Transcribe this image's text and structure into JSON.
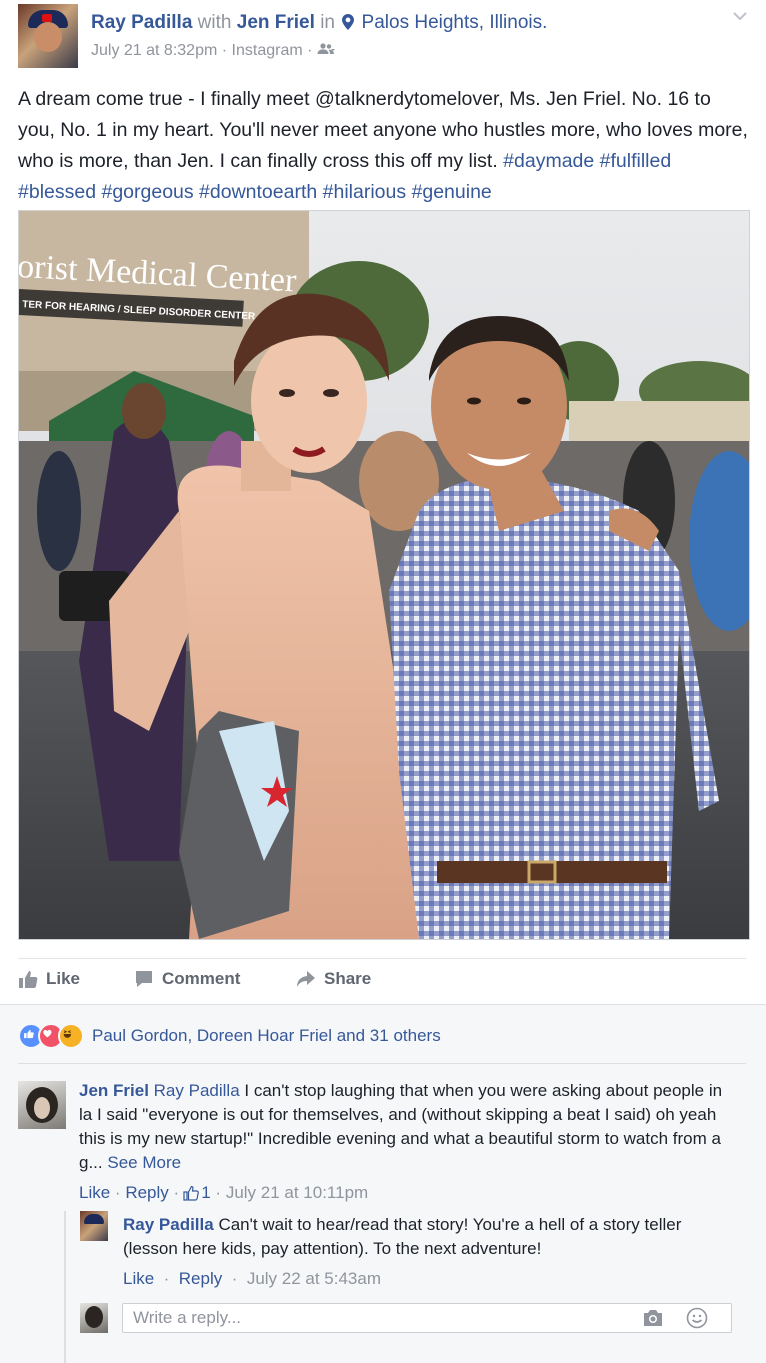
{
  "post": {
    "author": "Ray Padilla",
    "with_label": "with",
    "tagged": "Jen Friel",
    "in_label": "in",
    "location": "Palos Heights, Illinois.",
    "timestamp": "July 21 at 8:32pm",
    "via": "Instagram",
    "dot": "·",
    "text": "A dream come true - I finally meet @talknerdytomelover, Ms. Jen Friel. No. 16 to you, No. 1 in my heart. You'll never meet anyone who hustles more, who loves more, who is more, than Jen. I can finally cross this off my list.",
    "hashtags": "#daymade #fulfilled #blessed #gorgeous #downtoearth #hilarious #genuine",
    "photo_sign_line1": "orist Medical Center",
    "photo_sign_line2": "TER FOR HEARING / SLEEP DISORDER CENTER"
  },
  "actions": {
    "like": "Like",
    "comment": "Comment",
    "share": "Share"
  },
  "reactions": {
    "summary": "Paul Gordon, Doreen Hoar Friel and 31 others"
  },
  "comment1": {
    "author": "Jen Friel",
    "mention": "Ray Padilla",
    "text": "I can't stop laughing that when you were asking about people in la I said \"everyone is out for themselves, and (without skipping a beat I said) oh yeah this is my new startup!\" Incredible evening and what a beautiful storm to watch from a g...",
    "see_more": "See More",
    "like": "Like",
    "reply": "Reply",
    "sep": "·",
    "like_count": "1",
    "timestamp": "July 21 at 10:11pm"
  },
  "reply1": {
    "author": "Ray Padilla",
    "text": "Can't wait to hear/read that story! You're a hell of a story teller (lesson here kids, pay attention). To the next adventure!",
    "like": "Like",
    "reply": "Reply",
    "sep": "·",
    "timestamp": "July 22 at 5:43am"
  },
  "reply_box": {
    "placeholder": "Write a reply..."
  },
  "colors": {
    "link": "#365899",
    "meta_grey": "#90949c",
    "comments_bg": "#f6f7f9",
    "like_blue": "#5890ff",
    "love_red": "#f25268",
    "haha_yellow": "#f7b125"
  }
}
